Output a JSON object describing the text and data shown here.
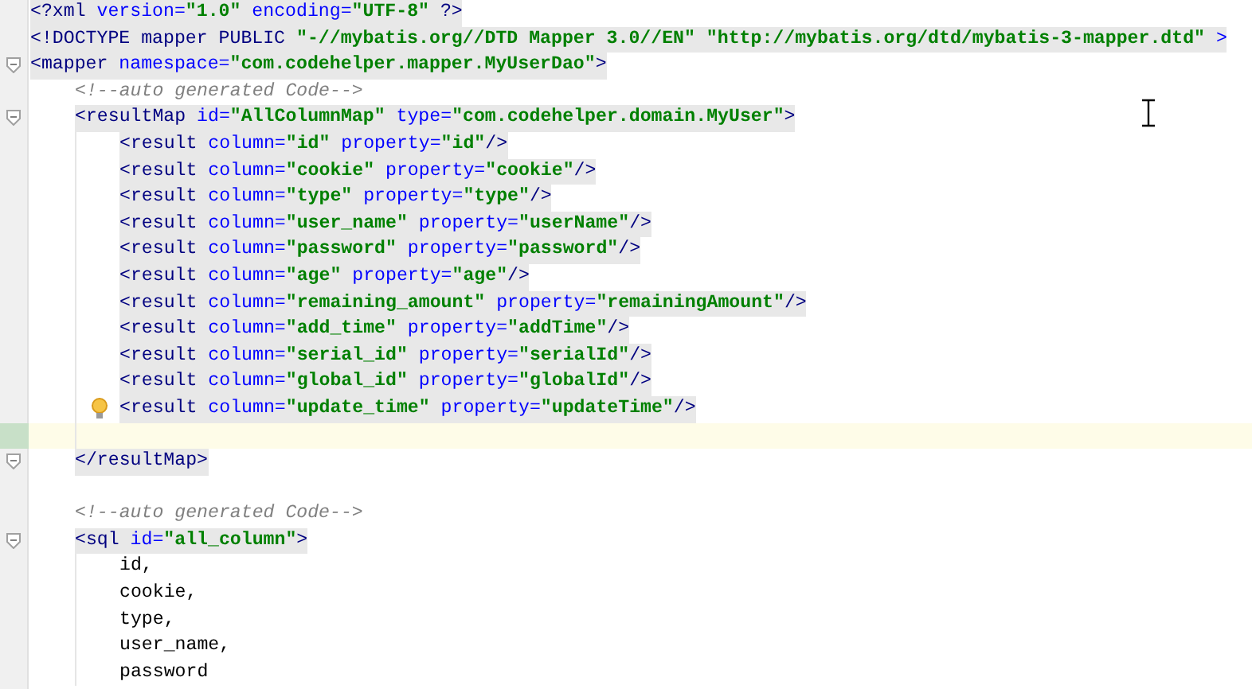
{
  "editor": {
    "lines": [
      {
        "highlight": true,
        "fold": false,
        "tokens": [
          {
            "kind": "tag",
            "text": "<?xml "
          },
          {
            "kind": "attr",
            "text": "version="
          },
          {
            "kind": "value",
            "text": "\"1.0\""
          },
          {
            "kind": "attr",
            "text": " encoding="
          },
          {
            "kind": "value",
            "text": "\"UTF-8\""
          },
          {
            "kind": "tag",
            "text": " ?>"
          }
        ]
      },
      {
        "highlight": true,
        "fold": false,
        "tokens": [
          {
            "kind": "tag",
            "text": "<!DOCTYPE mapper PUBLIC "
          },
          {
            "kind": "value",
            "text": "\"-//mybatis.org//DTD Mapper 3.0//EN\" \"http://mybatis.org/dtd/mybatis-3-mapper.dtd\""
          },
          {
            "kind": "attr",
            "text": " >"
          }
        ]
      },
      {
        "highlight": true,
        "fold": true,
        "tokens": [
          {
            "kind": "tag",
            "text": "<mapper "
          },
          {
            "kind": "attr",
            "text": "namespace="
          },
          {
            "kind": "value",
            "text": "\"com.codehelper.mapper.MyUserDao\""
          },
          {
            "kind": "tag",
            "text": ">"
          }
        ],
        "children": [
          {
            "highlight": false,
            "fold": false,
            "tokens": [
              {
                "kind": "comment",
                "text": "<!--auto generated Code-->"
              }
            ]
          },
          {
            "highlight": true,
            "fold": true,
            "tokens": [
              {
                "kind": "tag",
                "text": "<resultMap "
              },
              {
                "kind": "attr",
                "text": "id="
              },
              {
                "kind": "value",
                "text": "\"AllColumnMap\""
              },
              {
                "kind": "attr",
                "text": " type="
              },
              {
                "kind": "value",
                "text": "\"com.codehelper.domain.MyUser\""
              },
              {
                "kind": "tag",
                "text": ">"
              }
            ],
            "children": [
              {
                "highlight": true,
                "fold": false,
                "tokens": [
                  {
                    "kind": "tag",
                    "text": "<result "
                  },
                  {
                    "kind": "attr",
                    "text": "column="
                  },
                  {
                    "kind": "value",
                    "text": "\"id\""
                  },
                  {
                    "kind": "attr",
                    "text": " property="
                  },
                  {
                    "kind": "value",
                    "text": "\"id\""
                  },
                  {
                    "kind": "tag",
                    "text": "/>"
                  }
                ]
              },
              {
                "highlight": true,
                "fold": false,
                "tokens": [
                  {
                    "kind": "tag",
                    "text": "<result "
                  },
                  {
                    "kind": "attr",
                    "text": "column="
                  },
                  {
                    "kind": "value",
                    "text": "\"cookie\""
                  },
                  {
                    "kind": "attr",
                    "text": " property="
                  },
                  {
                    "kind": "value",
                    "text": "\"cookie\""
                  },
                  {
                    "kind": "tag",
                    "text": "/>"
                  }
                ]
              },
              {
                "highlight": true,
                "fold": false,
                "tokens": [
                  {
                    "kind": "tag",
                    "text": "<result "
                  },
                  {
                    "kind": "attr",
                    "text": "column="
                  },
                  {
                    "kind": "value",
                    "text": "\"type\""
                  },
                  {
                    "kind": "attr",
                    "text": " property="
                  },
                  {
                    "kind": "value",
                    "text": "\"type\""
                  },
                  {
                    "kind": "tag",
                    "text": "/>"
                  }
                ]
              },
              {
                "highlight": true,
                "fold": false,
                "tokens": [
                  {
                    "kind": "tag",
                    "text": "<result "
                  },
                  {
                    "kind": "attr",
                    "text": "column="
                  },
                  {
                    "kind": "value",
                    "text": "\"user_name\""
                  },
                  {
                    "kind": "attr",
                    "text": " property="
                  },
                  {
                    "kind": "value",
                    "text": "\"userName\""
                  },
                  {
                    "kind": "tag",
                    "text": "/>"
                  }
                ]
              },
              {
                "highlight": true,
                "fold": false,
                "tokens": [
                  {
                    "kind": "tag",
                    "text": "<result "
                  },
                  {
                    "kind": "attr",
                    "text": "column="
                  },
                  {
                    "kind": "value",
                    "text": "\"password\""
                  },
                  {
                    "kind": "attr",
                    "text": " property="
                  },
                  {
                    "kind": "value",
                    "text": "\"password\""
                  },
                  {
                    "kind": "tag",
                    "text": "/>"
                  }
                ]
              },
              {
                "highlight": true,
                "fold": false,
                "tokens": [
                  {
                    "kind": "tag",
                    "text": "<result "
                  },
                  {
                    "kind": "attr",
                    "text": "column="
                  },
                  {
                    "kind": "value",
                    "text": "\"age\""
                  },
                  {
                    "kind": "attr",
                    "text": " property="
                  },
                  {
                    "kind": "value",
                    "text": "\"age\""
                  },
                  {
                    "kind": "tag",
                    "text": "/>"
                  }
                ]
              },
              {
                "highlight": true,
                "fold": false,
                "tokens": [
                  {
                    "kind": "tag",
                    "text": "<result "
                  },
                  {
                    "kind": "attr",
                    "text": "column="
                  },
                  {
                    "kind": "value",
                    "text": "\"remaining_amount\""
                  },
                  {
                    "kind": "attr",
                    "text": " property="
                  },
                  {
                    "kind": "value",
                    "text": "\"remainingAmount\""
                  },
                  {
                    "kind": "tag",
                    "text": "/>"
                  }
                ]
              },
              {
                "highlight": true,
                "fold": false,
                "tokens": [
                  {
                    "kind": "tag",
                    "text": "<result "
                  },
                  {
                    "kind": "attr",
                    "text": "column="
                  },
                  {
                    "kind": "value",
                    "text": "\"add_time\""
                  },
                  {
                    "kind": "attr",
                    "text": " property="
                  },
                  {
                    "kind": "value",
                    "text": "\"addTime\""
                  },
                  {
                    "kind": "tag",
                    "text": "/>"
                  }
                ]
              },
              {
                "highlight": true,
                "fold": false,
                "tokens": [
                  {
                    "kind": "tag",
                    "text": "<result "
                  },
                  {
                    "kind": "attr",
                    "text": "column="
                  },
                  {
                    "kind": "value",
                    "text": "\"serial_id\""
                  },
                  {
                    "kind": "attr",
                    "text": " property="
                  },
                  {
                    "kind": "value",
                    "text": "\"serialId\""
                  },
                  {
                    "kind": "tag",
                    "text": "/>"
                  }
                ]
              },
              {
                "highlight": true,
                "fold": false,
                "tokens": [
                  {
                    "kind": "tag",
                    "text": "<result "
                  },
                  {
                    "kind": "attr",
                    "text": "column="
                  },
                  {
                    "kind": "value",
                    "text": "\"global_id\""
                  },
                  {
                    "kind": "attr",
                    "text": " property="
                  },
                  {
                    "kind": "value",
                    "text": "\"globalId\""
                  },
                  {
                    "kind": "tag",
                    "text": "/>"
                  }
                ]
              },
              {
                "highlight": true,
                "fold": false,
                "bulb": true,
                "tokens": [
                  {
                    "kind": "tag",
                    "text": "<result "
                  },
                  {
                    "kind": "attr",
                    "text": "column="
                  },
                  {
                    "kind": "value",
                    "text": "\"update_time\""
                  },
                  {
                    "kind": "attr",
                    "text": " property="
                  },
                  {
                    "kind": "value",
                    "text": "\"updateTime\""
                  },
                  {
                    "kind": "tag",
                    "text": "/>"
                  }
                ]
              },
              {
                "kind": "blank",
                "current": true
              }
            ]
          },
          {
            "highlight": true,
            "fold": true,
            "tokens": [
              {
                "kind": "tag",
                "text": "</resultMap>"
              }
            ]
          },
          {
            "kind": "blank"
          },
          {
            "highlight": false,
            "fold": false,
            "tokens": [
              {
                "kind": "comment",
                "text": "<!--auto generated Code-->"
              }
            ]
          },
          {
            "highlight": true,
            "fold": true,
            "tokens": [
              {
                "kind": "tag",
                "text": "<sql "
              },
              {
                "kind": "attr",
                "text": "id="
              },
              {
                "kind": "value",
                "text": "\"all_column\""
              },
              {
                "kind": "tag",
                "text": ">"
              }
            ],
            "children": [
              {
                "highlight": false,
                "fold": false,
                "tokens": [
                  {
                    "kind": "text",
                    "text": "id,"
                  }
                ]
              },
              {
                "highlight": false,
                "fold": false,
                "tokens": [
                  {
                    "kind": "text",
                    "text": "cookie,"
                  }
                ]
              },
              {
                "highlight": false,
                "fold": false,
                "tokens": [
                  {
                    "kind": "text",
                    "text": "type,"
                  }
                ]
              },
              {
                "highlight": false,
                "fold": false,
                "tokens": [
                  {
                    "kind": "text",
                    "text": "user_name,"
                  }
                ]
              },
              {
                "highlight": false,
                "fold": false,
                "tokens": [
                  {
                    "kind": "text",
                    "text": "password"
                  }
                ]
              }
            ]
          }
        ]
      }
    ]
  }
}
